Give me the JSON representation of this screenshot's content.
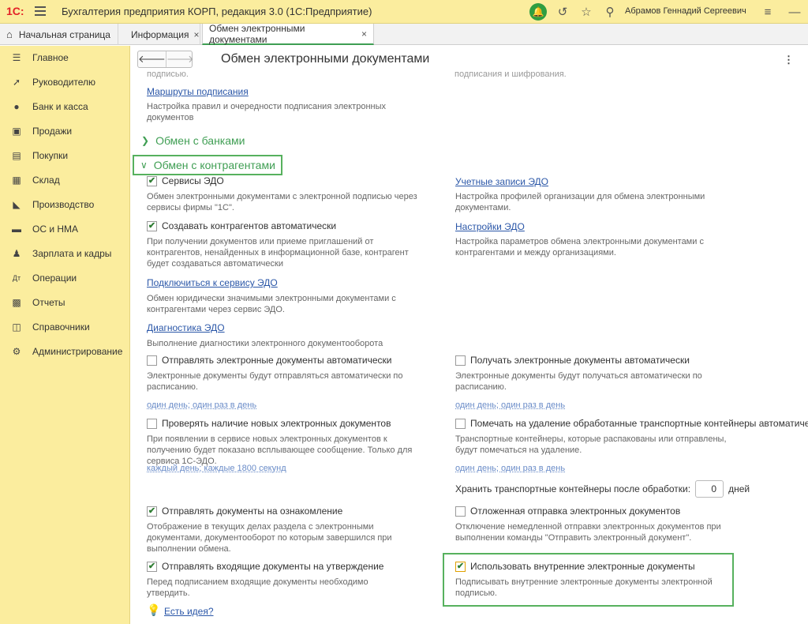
{
  "app": {
    "logo": "1С:",
    "title": "Бухгалтерия предприятия КОРП, редакция 3.0  (1С:Предприятие)",
    "user": "Абрамов Геннадий Сергеевич"
  },
  "tabs": [
    {
      "label": "Начальная страница"
    },
    {
      "label": "Информация",
      "close": "×"
    },
    {
      "label": "Обмен электронными документами",
      "close": "×"
    }
  ],
  "sidebar": {
    "items": [
      {
        "label": "Главное",
        "icon": "list-icon"
      },
      {
        "label": "Руководителю",
        "icon": "trend-icon"
      },
      {
        "label": "Банк и касса",
        "icon": "coin-icon"
      },
      {
        "label": "Продажи",
        "icon": "bag-icon"
      },
      {
        "label": "Покупки",
        "icon": "cart-icon"
      },
      {
        "label": "Склад",
        "icon": "warehouse-icon"
      },
      {
        "label": "Производство",
        "icon": "factory-icon"
      },
      {
        "label": "ОС и НМА",
        "icon": "truck-icon"
      },
      {
        "label": "Зарплата и кадры",
        "icon": "person-icon"
      },
      {
        "label": "Операции",
        "icon": "operations-icon"
      },
      {
        "label": "Отчеты",
        "icon": "bar-chart-icon"
      },
      {
        "label": "Справочники",
        "icon": "book-icon"
      },
      {
        "label": "Администрирование",
        "icon": "gear-icon"
      }
    ]
  },
  "page": {
    "title": "Обмен электронными документами",
    "back": "🡐",
    "forward": "🡒",
    "more": "⋮"
  },
  "content": {
    "faded_left": "подписью.",
    "faded_right": "подписания и шифрования.",
    "routes_link": "Маршруты подписания",
    "routes_desc": "Настройка правил и очередности подписания электронных документов",
    "banks_group": "Обмен с банками",
    "contractors_group": "Обмен с контрагентами",
    "edo_services": {
      "label": "Сервисы ЭДО",
      "checked": true,
      "desc": "Обмен электронными документами с электронной подписью через сервисы фирмы \"1С\"."
    },
    "edo_accounts": {
      "link": "Учетные записи ЭДО",
      "desc": "Настройка профилей организации для обмена электронными документами."
    },
    "create_contractors": {
      "label": "Создавать контрагентов автоматически",
      "checked": true,
      "desc": "При получении документов или приеме приглашений от контрагентов, ненайденных в информационной базе, контрагент будет создаваться автоматически"
    },
    "edo_settings": {
      "link": "Настройки ЭДО",
      "desc": "Настройка параметров обмена электронными документами с контрагентами и между организациями."
    },
    "connect_service": {
      "link": "Подключиться к сервису ЭДО",
      "desc": "Обмен юридически значимыми электронными документами с контрагентами через сервис ЭДО."
    },
    "diagnostics": {
      "link": "Диагностика ЭДО",
      "desc": "Выполнение диагностики электронного документооборота"
    },
    "send_auto": {
      "label": "Отправлять электронные документы автоматически",
      "checked": false,
      "desc": "Электронные документы будут отправляться автоматически по расписанию.",
      "schedule": "один день; один раз в день"
    },
    "receive_auto": {
      "label": "Получать электронные документы автоматически",
      "checked": false,
      "desc": "Электронные документы будут получаться автоматически по расписанию.",
      "schedule": "один день; один раз в день"
    },
    "check_new": {
      "label": "Проверять наличие новых электронных документов",
      "checked": false,
      "desc": "При появлении в сервисе новых электронных документов к получению будет показано всплывающее сообщение. Только для сервиса 1С-ЭДО.",
      "schedule": "каждый день; каждые 1800 секунд"
    },
    "mark_delete": {
      "label": "Помечать на удаление обработанные транспортные контейнеры автоматически",
      "checked": false,
      "desc": "Транспортные контейнеры, которые распакованы или отправлены, будут помечаться на удаление.",
      "schedule": "один день; один раз в день"
    },
    "keep_containers": {
      "label": "Хранить транспортные контейнеры после обработки:",
      "value": "0",
      "unit": "дней"
    },
    "send_review": {
      "label": "Отправлять документы на ознакомление",
      "checked": true,
      "desc": "Отображение в текущих делах  раздела с электронными документами, документооборот по которым завершился при выполнении обмена."
    },
    "delayed_send": {
      "label": "Отложенная отправка электронных документов",
      "checked": false,
      "desc": "Отключение немедленной отправки электронных документов при выполнении команды \"Отправить электронный документ\"."
    },
    "send_incoming_approval": {
      "label": "Отправлять входящие документы на утверждение",
      "checked": true,
      "desc": "Перед подписанием входящие документы необходимо утвердить."
    },
    "use_internal": {
      "label": "Использовать внутренние электронные документы",
      "checked": true,
      "desc": "Подписывать внутренние электронные документы электронной подписью."
    },
    "idea_link": "Есть идея?"
  }
}
